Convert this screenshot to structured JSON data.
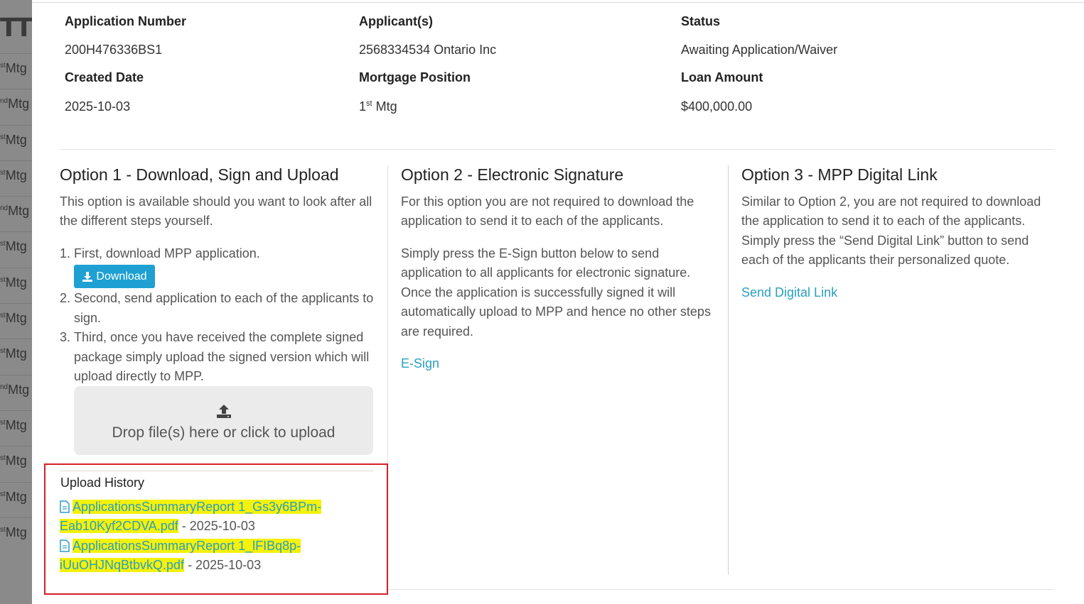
{
  "left_strip": {
    "logo_text": "TT",
    "rows": [
      {
        "sup": "st",
        "text": "Mtg"
      },
      {
        "sup": "nd",
        "text": "Mtg"
      },
      {
        "sup": "st",
        "text": "Mtg"
      },
      {
        "sup": "st",
        "text": "Mtg"
      },
      {
        "sup": "nd",
        "text": "Mtg"
      },
      {
        "sup": "st",
        "text": "Mtg"
      },
      {
        "sup": "st",
        "text": "Mtg"
      },
      {
        "sup": "st",
        "text": "Mtg"
      },
      {
        "sup": "st",
        "text": "Mtg"
      },
      {
        "sup": "nd",
        "text": "Mtg"
      },
      {
        "sup": "st",
        "text": "Mtg"
      },
      {
        "sup": "st",
        "text": "Mtg"
      },
      {
        "sup": "st",
        "text": "Mtg"
      },
      {
        "sup": "st",
        "text": "Mtg"
      }
    ]
  },
  "summary": {
    "application_number_label": "Application Number",
    "application_number": "200H476336BS1",
    "applicants_label": "Applicant(s)",
    "applicants": "2568334534 Ontario Inc",
    "status_label": "Status",
    "status": "Awaiting Application/Waiver",
    "created_date_label": "Created Date",
    "created_date": "2025-10-03",
    "mortgage_position_label": "Mortgage Position",
    "mortgage_position_num": "1",
    "mortgage_position_sup": "st",
    "mortgage_position_text": " Mtg",
    "loan_amount_label": "Loan Amount",
    "loan_amount": "$400,000.00"
  },
  "option1": {
    "title": "Option 1 - Download, Sign and Upload",
    "description": "This option is available should you want to look after all the different steps yourself.",
    "steps": [
      {
        "num": "1.",
        "text": "First, download MPP application."
      },
      {
        "num": "2.",
        "text": "Second, send application to each of the applicants to sign."
      },
      {
        "num": "3.",
        "text": "Third, once you have received the complete signed package simply upload the signed version which will upload directly to MPP."
      }
    ],
    "download_label": "Download",
    "dropzone_label": "Drop file(s) here or click to upload"
  },
  "upload_history": {
    "title": "Upload History",
    "files": [
      {
        "name_line1": "ApplicationsSummaryReport 1_Gs3y6BPm-",
        "name_line2": "Eab10Kyf2CDVA.pdf",
        "date": " - 2025-10-03"
      },
      {
        "name_line1": "ApplicationsSummaryReport 1_lFIBq8p-",
        "name_line2": "iUuOHJNqBtbvkQ.pdf",
        "date": " - 2025-10-03"
      }
    ]
  },
  "option2": {
    "title": "Option 2 - Electronic Signature",
    "para1": "For this option you are not required to download the application to send it to each of the applicants.",
    "para2": "Simply press the E-Sign button below to send application to all applicants for electronic signature. Once the application is successfully signed it will automatically upload to MPP and hence no other steps are required.",
    "link": "E-Sign"
  },
  "option3": {
    "title": "Option 3 - MPP Digital Link",
    "para1": "Similar to Option 2, you are not required to download the application to send it to each of the applicants. Simply press the “Send Digital Link” button to send each of the applicants their personalized quote.",
    "link": "Send Digital Link"
  },
  "colors": {
    "link": "#2a9fc0",
    "button": "#1ea0d2",
    "highlight": "#f4f10a",
    "annotation_box": "#d42027"
  }
}
